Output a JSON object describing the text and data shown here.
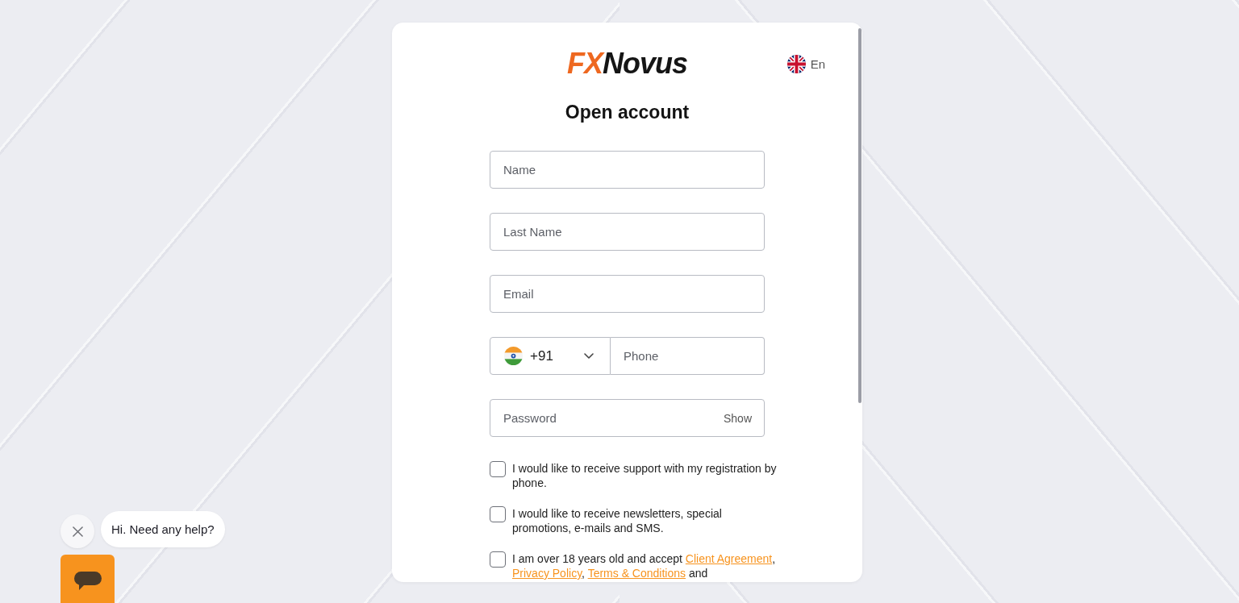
{
  "header": {
    "logo": {
      "prefix": "FX",
      "name": "Novus"
    },
    "language": {
      "label": "En"
    }
  },
  "title": "Open account",
  "fields": [
    {
      "kind": "text",
      "placeholder": "Name"
    },
    {
      "kind": "text",
      "placeholder": "Last Name"
    },
    {
      "kind": "text",
      "placeholder": "Email"
    },
    {
      "kind": "phone",
      "country_code": "+91",
      "placeholder": "Phone"
    },
    {
      "kind": "password",
      "placeholder": "Password",
      "toggle": "Show"
    }
  ],
  "consents": [
    {
      "checked": false,
      "segments": [
        {
          "kind": "text",
          "text": "I would like to receive support with my registration by phone."
        }
      ]
    },
    {
      "checked": false,
      "segments": [
        {
          "kind": "text",
          "text": "I would like to receive newsletters, special promotions, e-mails and SMS."
        }
      ]
    },
    {
      "checked": false,
      "segments": [
        {
          "kind": "text",
          "text": "I am over 18 years old and accept "
        },
        {
          "kind": "link",
          "text": "Client Agreement"
        },
        {
          "kind": "text",
          "text": ", "
        },
        {
          "kind": "link",
          "text": "Privacy Policy"
        },
        {
          "kind": "text",
          "text": ", "
        },
        {
          "kind": "link",
          "text": "Terms & Conditions"
        },
        {
          "kind": "text",
          "text": " and"
        }
      ]
    }
  ],
  "chat_widget": {
    "greeting": "Hi. Need any help?"
  }
}
